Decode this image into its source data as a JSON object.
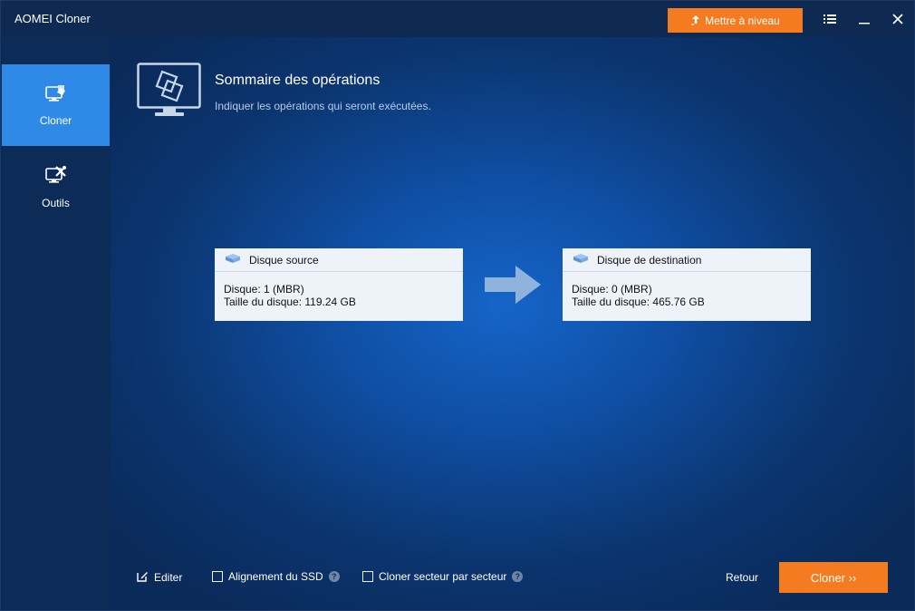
{
  "app": {
    "title": "AOMEI Cloner"
  },
  "titlebar": {
    "upgrade_label": "Mettre à niveau",
    "icons": [
      "upgrade-arrow-icon",
      "menu-icon",
      "minimize-icon",
      "close-icon"
    ]
  },
  "sidebar": {
    "items": [
      {
        "label": "Cloner",
        "icon": "clone-icon",
        "active": true
      },
      {
        "label": "Outils",
        "icon": "tools-icon",
        "active": false
      }
    ]
  },
  "header": {
    "title": "Sommaire des opérations",
    "subtitle": "Indiquer les opérations qui seront exécutées."
  },
  "source": {
    "title": "Disque source",
    "disk": "Disque: 1 (MBR)",
    "size": "Taille du disque: 119.24 GB"
  },
  "destination": {
    "title": "Disque de destination",
    "disk": "Disque: 0 (MBR)",
    "size": "Taille du disque: 465.76 GB"
  },
  "options": {
    "edit_label": "Editer",
    "ssd_label": "Alignement du SSD",
    "ssd_checked": false,
    "sector_label": "Cloner secteur par secteur",
    "sector_checked": false
  },
  "footer": {
    "back_label": "Retour",
    "clone_label": "Cloner ››"
  },
  "colors": {
    "accent": "#f47b20",
    "sidebar_active": "#2e8ae6",
    "sidebar_bg": "#0d2b57",
    "titlebar_bg": "#0e2a52",
    "card_bg": "#eef3fa"
  }
}
